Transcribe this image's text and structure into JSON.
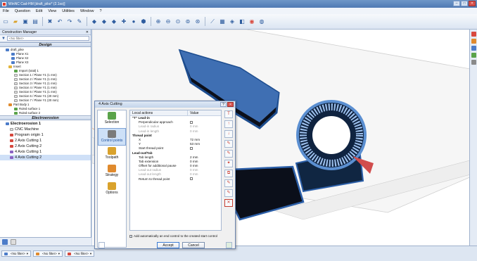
{
  "window": {
    "title": "WinNC Cad-HM  [draft_pike* (2.1ss)]"
  },
  "menu": [
    "File",
    "Question",
    "Edit",
    "View",
    "Utilities",
    "Window",
    "?"
  ],
  "left_panel": {
    "title": "Construction Manager",
    "filter_placeholder": "<No filter>",
    "design_header": "Design",
    "design_tree": [
      "draft_pike",
      "Plane X1",
      "Plane X2",
      "Plane X3",
      "Insert",
      "Import (total) 1",
      "Section 1 / Plane Y1 (1 mm)",
      "Section 2 / Plane Y1 (1 mm)",
      "Section 3 / Plane Y1 (1 mm)",
      "Section 4 / Plane Y1 (1 mm)",
      "Section 5 / Plane Y1 (1 mm)",
      "Section 6 / Plane Y1 (20 mm)",
      "Section 7 / Plane Y1 (20 mm)",
      "Part Body 1",
      "Ruled surface 1",
      "Ruled surface 2"
    ],
    "electro_header": "Electroerosion",
    "electro_tree": [
      "Electroerosion 1",
      "CNC Machine",
      "Program origin 1",
      "2 Axis Cutting 1",
      "2 Axis Cutting 2",
      "4 Axis Cutting 1",
      "4 Axis Cutting 2"
    ]
  },
  "status": {
    "tabs": [
      "<No filter>",
      "<No filter>",
      "<No filter>"
    ]
  },
  "dialog": {
    "title": "4 Axis Cutting",
    "nav": [
      "Selection",
      "Control points",
      "Toolpath",
      "Strategy",
      "Options"
    ],
    "col_actions": "Local actions",
    "col_value": "Value",
    "rows": [
      {
        "k": "\"T\" Lead-in",
        "v": "",
        "t": "cat"
      },
      {
        "k": "Perpendicular approach",
        "v": "chk",
        "t": ""
      },
      {
        "k": "Lead-in radius",
        "v": "0 mm",
        "t": "dis"
      },
      {
        "k": "Lead-in length",
        "v": "0 mm",
        "t": "dis"
      },
      {
        "k": "Thread point",
        "v": "",
        "t": "cat"
      },
      {
        "k": "X",
        "v": "72 mm",
        "t": ""
      },
      {
        "k": "Y",
        "v": "53 mm",
        "t": ""
      },
      {
        "k": "Start thread point",
        "v": "chk",
        "t": ""
      },
      {
        "k": "Lead-out/Tab",
        "v": "",
        "t": "cat"
      },
      {
        "k": "Tab length",
        "v": "2 mm",
        "t": ""
      },
      {
        "k": "Tab extension",
        "v": "0 mm",
        "t": ""
      },
      {
        "k": "Offset for additional pause",
        "v": "0 mm",
        "t": ""
      },
      {
        "k": "Lead-out radius",
        "v": "0 mm",
        "t": "dis"
      },
      {
        "k": "Lead-out length",
        "v": "0 mm",
        "t": "dis"
      },
      {
        "k": "Return to thread point",
        "v": "chk",
        "t": ""
      }
    ],
    "option_text": "Add automatically an end control to the created start control",
    "accept": "Accept",
    "cancel": "Cancel"
  }
}
